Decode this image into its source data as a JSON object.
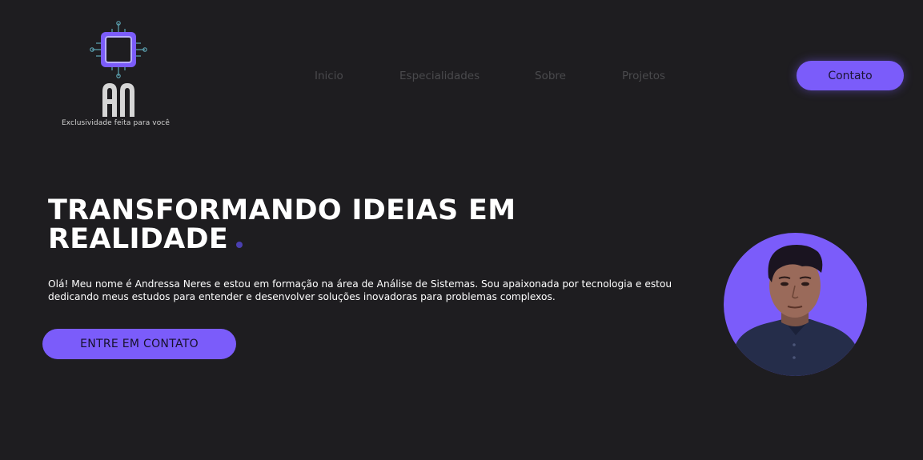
{
  "brand": {
    "monogram": "AN",
    "tagline": "Exclusividade feita para você",
    "accent_color": "#7b5cfa",
    "background_color": "#1e1d20"
  },
  "nav": {
    "items": [
      {
        "label": "Inicio"
      },
      {
        "label": "Especialidades"
      },
      {
        "label": "Sobre"
      },
      {
        "label": "Projetos"
      }
    ],
    "cta_label": "Contato"
  },
  "hero": {
    "title_line1": "TRANSFORMANDO IDEIAS EM",
    "title_line2": "REALIDADE",
    "description": "Olá! Meu nome é Andressa Neres e estou em formação na área de Análise de Sistemas. Sou apaixonada por tecnologia e estou dedicando meus estudos para entender e desenvolver soluções inovadoras para problemas complexos.",
    "cta_label": "ENTRE EM CONTATO"
  },
  "avatar": {
    "icon": "profile-photo"
  }
}
